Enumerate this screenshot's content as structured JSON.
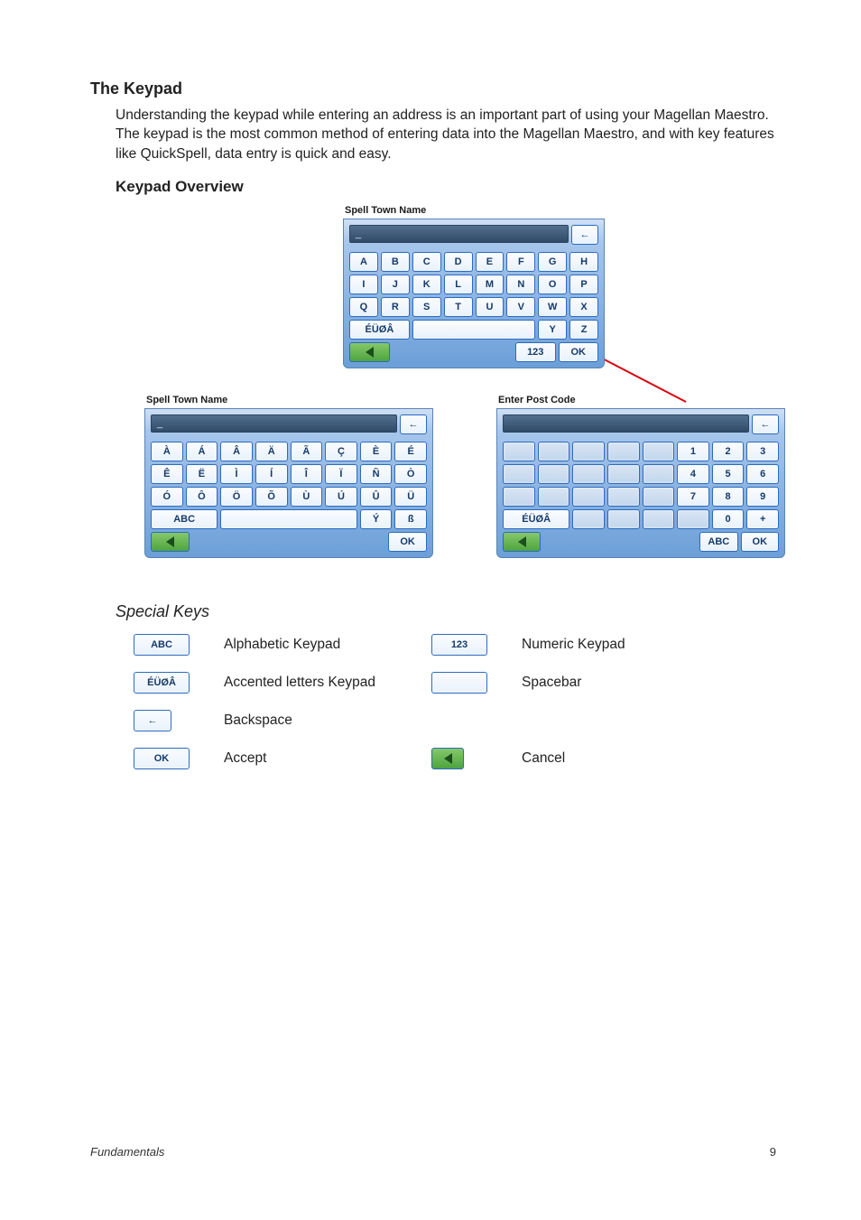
{
  "section_title": "The Keypad",
  "body_text": "Understanding the keypad while entering an address is an important part of using your Magellan Maestro.  The keypad is the most common method of entering data into the Magellan Maestro, and with  key features like QuickSpell, data entry is quick and easy.",
  "overview_title": "Keypad Overview",
  "main_kp": {
    "title": "Spell Town Name",
    "cursor": "_",
    "bksp": "←",
    "rows": [
      [
        "A",
        "B",
        "C",
        "D",
        "E",
        "F",
        "G",
        "H"
      ],
      [
        "I",
        "J",
        "K",
        "L",
        "M",
        "N",
        "O",
        "P"
      ],
      [
        "Q",
        "R",
        "S",
        "T",
        "U",
        "V",
        "W",
        "X"
      ]
    ],
    "accent_key": "ÉÜØÂ",
    "y": "Y",
    "z": "Z",
    "num_key": "123",
    "ok": "OK"
  },
  "accent_kp": {
    "title": "Spell Town Name",
    "cursor": "_",
    "bksp": "←",
    "rows": [
      [
        "À",
        "Á",
        "Â",
        "Ä",
        "Ã",
        "Ç",
        "È",
        "É"
      ],
      [
        "Ê",
        "Ë",
        "Ì",
        "Í",
        "Î",
        "Ï",
        "Ñ",
        "Ò"
      ],
      [
        "Ó",
        "Ô",
        "Ö",
        "Õ",
        "Ù",
        "Ú",
        "Û",
        "Ü"
      ]
    ],
    "abc": "ABC",
    "ydot": "Ý",
    "beta": "ß",
    "ok": "OK"
  },
  "num_kp": {
    "title": "Enter Post Code",
    "bksp": "←",
    "nums": [
      [
        "1",
        "2",
        "3"
      ],
      [
        "4",
        "5",
        "6"
      ],
      [
        "7",
        "8",
        "9"
      ],
      [
        "0",
        "+"
      ]
    ],
    "accent_key": "ÉÜØÂ",
    "abc": "ABC",
    "ok": "OK"
  },
  "special": {
    "title": "Special Keys",
    "abc": "ABC",
    "abc_label": "Alphabetic Keypad",
    "num": "123",
    "num_label": "Numeric Keypad",
    "accent": "ÉÜØÂ",
    "accent_label": "Accented letters Keypad",
    "space_label": "Spacebar",
    "bksp": "←",
    "bksp_label": "Backspace",
    "ok": "OK",
    "ok_label": "Accept",
    "cancel_label": "Cancel"
  },
  "footer_left": "Fundamentals",
  "footer_right": "9"
}
